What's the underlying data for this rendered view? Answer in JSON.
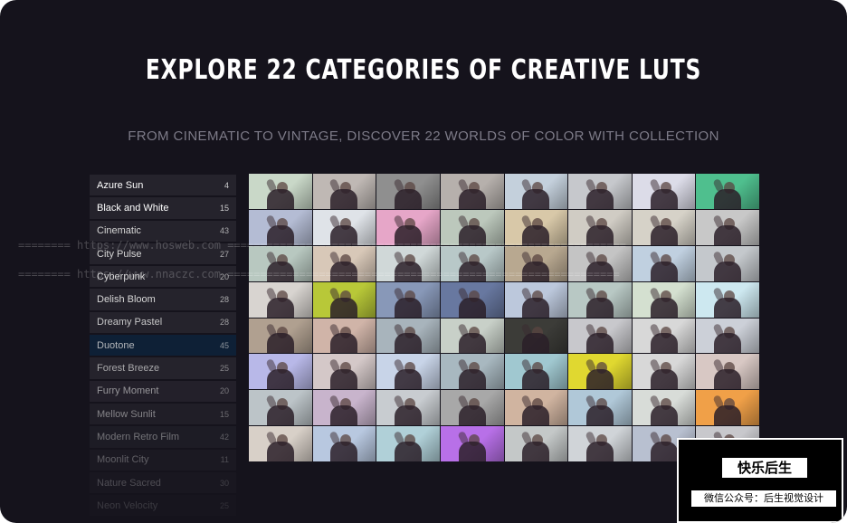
{
  "headline": "EXPLORE 22 CATEGORIES OF CREATIVE LUTS",
  "subheadline": "FROM CINEMATIC TO VINTAGE, DISCOVER 22 WORLDS OF COLOR WITH COLLECTION",
  "categories": [
    {
      "name": "Azure Sun",
      "count": "4"
    },
    {
      "name": "Black and White",
      "count": "15"
    },
    {
      "name": "Cinematic",
      "count": "43"
    },
    {
      "name": "City Pulse",
      "count": "27"
    },
    {
      "name": "Cyberpunk",
      "count": "20"
    },
    {
      "name": "Delish Bloom",
      "count": "28"
    },
    {
      "name": "Dreamy Pastel",
      "count": "28"
    },
    {
      "name": "Duotone",
      "count": "45"
    },
    {
      "name": "Forest Breeze",
      "count": "25"
    },
    {
      "name": "Furry Moment",
      "count": "20"
    },
    {
      "name": "Mellow Sunlit",
      "count": "15"
    },
    {
      "name": "Modern Retro Film",
      "count": "42"
    },
    {
      "name": "Moonlit City",
      "count": "11"
    },
    {
      "name": "Nature Sacred",
      "count": "30"
    },
    {
      "name": "Neon Velocity",
      "count": "25"
    }
  ],
  "active_category": "Duotone",
  "watermark": {
    "line1": "======== https://www.hosweb.com =============================================================",
    "line2": "======== https://www.nnaczc.com ============================================================"
  },
  "logo": {
    "title": "快乐后生",
    "subtitle": "微信公众号：后生视觉设计"
  },
  "colors": {
    "background": "#15131c",
    "list_item": "#25232c",
    "list_active": "#0e2036",
    "headline": "#ffffff",
    "subheadline": "#7d7b88"
  },
  "grid": {
    "rows": 8,
    "cols": 8,
    "tiles": [
      [
        "#c9d8c8",
        "#bfb8b4",
        "#8f8f8f",
        "#b6b0ac",
        "#c4d0dc",
        "#c6c8cc",
        "#dcdce8",
        "#4fbf8e"
      ],
      [
        "#b4bcd4",
        "#dfe3e8",
        "#e6a6c8",
        "#bcc8bc",
        "#d8c8a8",
        "#d0ccc4",
        "#d6d2c8",
        "#c8c8c8"
      ],
      [
        "#b8c8c0",
        "#d8c8b8",
        "#d0d8d8",
        "#b8c8c8",
        "#b8a890",
        "#c4c4c4",
        "#c0d0e0",
        "#c4c8cc"
      ],
      [
        "#d8d4d0",
        "#b8c838",
        "#8898b8",
        "#6878a0",
        "#bcc8dc",
        "#b8c8c4",
        "#d4e0d0",
        "#cde8f0"
      ],
      [
        "#b0a090",
        "#d0b4a8",
        "#a8b4bc",
        "#c8d0c8",
        "#3c3c38",
        "#c8c8cc",
        "#d8d8d8",
        "#ccd0d8"
      ],
      [
        "#b8b8e8",
        "#d4c8c8",
        "#c8d4e8",
        "#a8b8c0",
        "#a0c8d0",
        "#e0d830",
        "#d8d8d8",
        "#d8c8c4"
      ],
      [
        "#bcc4c8",
        "#c8b4cc",
        "#c8ccd0",
        "#a8a8a8",
        "#d0b4a0",
        "#b0c8d8",
        "#d8dcd8",
        "#f0a048"
      ],
      [
        "#d8d0c8",
        "#b8c8e0",
        "#b0d0d8",
        "#b870e8",
        "#c4c8c8",
        "#d0d4d8",
        "#b8c0d0",
        "#c8c8cc"
      ]
    ]
  }
}
